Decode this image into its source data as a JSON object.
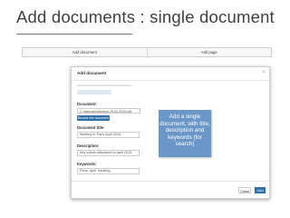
{
  "slide": {
    "title": "Add documents : single document"
  },
  "page_tabs": [
    "Add document",
    "Add page"
  ],
  "modal": {
    "title": "Add document",
    "close_glyph": "×",
    "document_label": "Document:",
    "file_value": "C:\\fakepath\\Meeting 25.04.2015.pdf",
    "browse_label": "Browse the document",
    "title_label": "Document title:",
    "title_value": "Meeting in Paris April 2015",
    "description_label": "Description:",
    "description_value": "Key points discussed in april 2015",
    "keywords_label": "Keywords:",
    "keywords_value": "Paris, april, meeting",
    "close_button": "Close",
    "add_button": "Add"
  },
  "callout": {
    "text": "Add a single document, with title, description and keywords (for search)"
  },
  "colors": {
    "accent": "#2e6fa7",
    "callout_bg": "#6b97c8",
    "title_text": "#404040"
  }
}
